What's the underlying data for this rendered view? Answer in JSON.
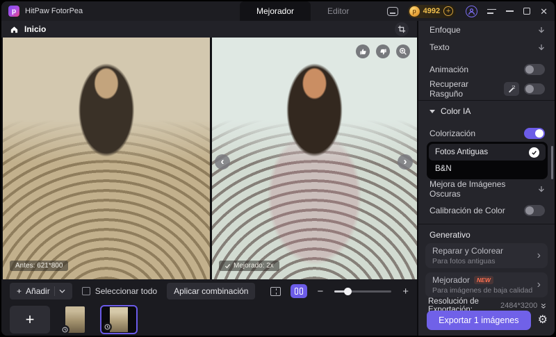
{
  "titlebar": {
    "app_name": "HitPaw FotorPea",
    "tab_mejorador": "Mejorador",
    "tab_editor": "Editor",
    "credits": "4992"
  },
  "breadcrumb": {
    "home": "Inicio"
  },
  "viewer": {
    "before_label": "Antes: 621*800",
    "after_label": "Mejorado: 2x"
  },
  "toolbar": {
    "add": "Añadir",
    "select_all": "Seleccionar todo",
    "apply_combination": "Aplicar combinación"
  },
  "sidebar": {
    "enfoque": "Enfoque",
    "texto": "Texto",
    "animacion": "Animación",
    "recuperar_rasguno": "Recuperar Rasguño",
    "color_ia": "Color IA",
    "colorizacion": "Colorización",
    "options": [
      {
        "label": "Fotos Antiguas",
        "selected": true
      },
      {
        "label": "B&N",
        "selected": false
      }
    ],
    "mejora_oscuras": "Mejora de Imágenes Oscuras",
    "calibracion": "Calibración de Color",
    "generativo": "Generativo",
    "card_repair_title": "Reparar y Colorear",
    "card_repair_subtitle": "Para fotos antiguas",
    "card_mejorador_title": "Mejorador",
    "card_mejorador_badge": "NEW",
    "card_mejorador_subtitle": "Para imágenes de baja calidad"
  },
  "export": {
    "resolution_label": "Resolución de Exportación:",
    "resolution_value": "2484*3200",
    "button": "Exportar 1 imágenes"
  },
  "colors": {
    "accent": "#6c5ce7",
    "credits_gold": "#f2c14d",
    "new_badge": "#ff7050"
  }
}
